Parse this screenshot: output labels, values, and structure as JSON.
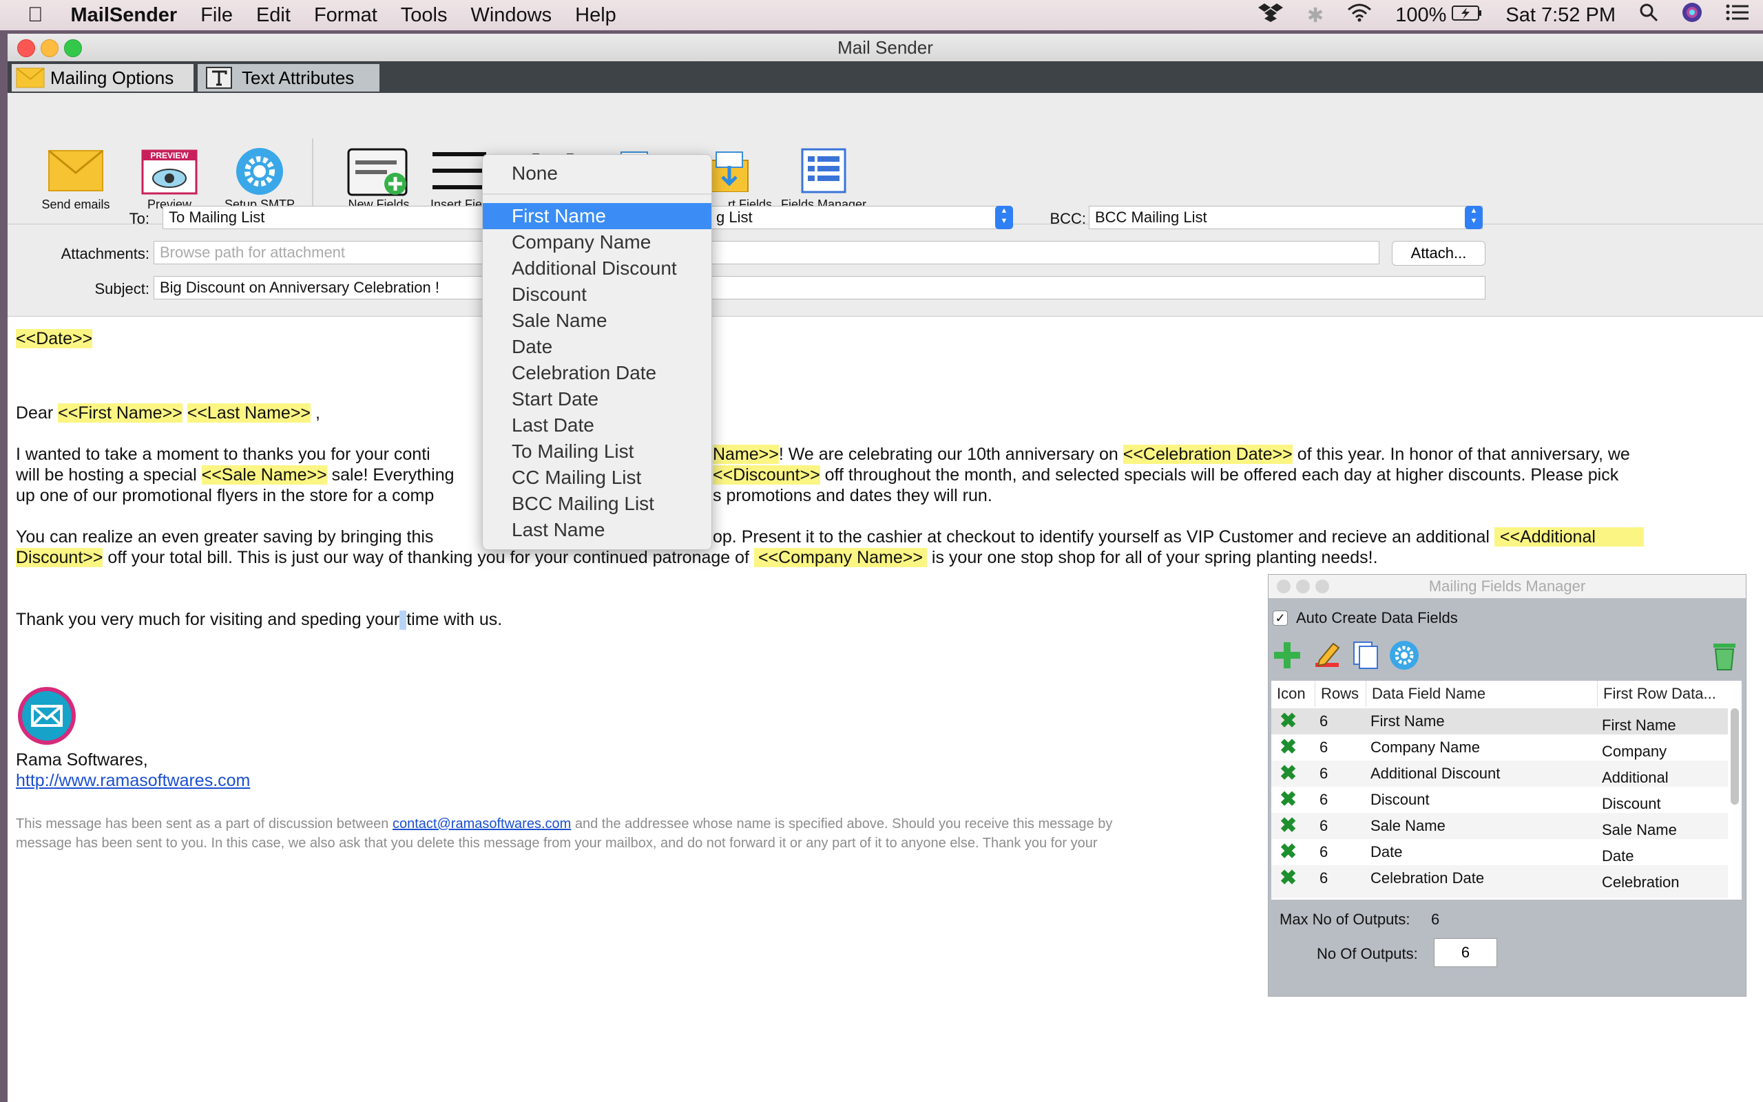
{
  "menubar": {
    "app": "MailSender",
    "items": [
      "File",
      "Edit",
      "Format",
      "Tools",
      "Windows",
      "Help"
    ],
    "battery": "100%",
    "clock": "Sat 7:52 PM"
  },
  "window": {
    "title": "Mail Sender",
    "tabs": [
      "Mailing Options",
      "Text Attributes"
    ]
  },
  "toolbar": {
    "send": "Send emails",
    "preview": "Preview",
    "preview_badge": "PREVIEW",
    "smtp": "Setup SMTP",
    "new_fields": "New Fields",
    "insert_fields": "Insert Fie",
    "export_fields": "rt Fields",
    "fields_manager": "Fields Manager"
  },
  "form": {
    "to_label": "To:",
    "to_value": "To Mailing List",
    "cc_value_partial": "g List",
    "bcc_label": "BCC:",
    "bcc_value": "BCC Mailing List",
    "attach_label": "Attachments:",
    "attach_placeholder": "Browse path for attachment",
    "attach_button": "Attach...",
    "subject_label": "Subject:",
    "subject_value": "Big Discount on Anniversary Celebration !"
  },
  "editor": {
    "date_tag": "<<Date>>",
    "dear": "Dear",
    "first_name_tag": "<<First Name>>",
    "last_name_tag": "<<Last Name>>",
    "comma": ",",
    "p1_l1_a": "I wanted to take a moment to thanks you for your conti",
    "p1_l1_tag": "Name>>",
    "p1_l1_b": "! We are celebrating our 10th anniversary on",
    "celebration_tag": "<<Celebration Date>>",
    "p1_l1_c": "of this year. In honor of that anniversary, we",
    "p1_l2_a": "will be hosting a special",
    "sale_tag": "<<Sale Name>>",
    "p1_l2_b": "sale! Everything",
    "discount_tag": "<<Discount>>",
    "p1_l2_c": "off throughout the month, and selected specials will be offered each day at higher discounts. Please pick",
    "p1_l3_a": "up one of our promotional flyers in the store for a comp",
    "p1_l3_b": "s promotions and dates they will run.",
    "p2_l1_a": "You can realize an even greater saving by bringing this",
    "p2_l1_b": "op. Present it to the cashier at checkout to identify yourself as VIP Customer and recieve an additional",
    "additional_tag": "<<Additional",
    "discount_cont_tag": "Discount>>",
    "p2_l2_b": "off your total bill. This is just our way of thanking you for your continued patronage of",
    "company_tag": "<<Company Name>>",
    "p2_l2_c": "is your one stop shop for all of your spring planting needs!.",
    "thanks_a": "Thank you very much for visiting and speding your",
    "thanks_b": "time with us.",
    "company": "Rama Softwares,",
    "website": "http://www.ramasoftwares.com",
    "footer_l1_a": "This message has been sent as a part of discussion between",
    "footer_email": "contact@ramasoftwares.com",
    "footer_l1_b": "and the addressee whose name is specified above. Should you receive this message by",
    "footer_l2": "message has been sent to you. In this case, we also ask that you delete this message from your mailbox, and do not forward it or any part of it to anyone else. Thank you for your"
  },
  "dropdown": {
    "items": [
      "None",
      "First Name",
      "Company Name",
      "Additional Discount",
      "Discount",
      "Sale Name",
      "Date",
      "Celebration Date",
      "Start Date",
      "Last Date",
      "To Mailing List",
      "CC Mailing List",
      "BCC Mailing List",
      "Last Name"
    ],
    "selected": "First Name"
  },
  "fields_manager": {
    "title": "Mailing Fields Manager",
    "auto_create": "Auto Create Data Fields",
    "auto_create_checked": true,
    "columns": [
      "Icon",
      "Rows",
      "Data Field Name",
      "First Row Data..."
    ],
    "rows": [
      {
        "rows": "6",
        "name": "First Name",
        "first": "First Name"
      },
      {
        "rows": "6",
        "name": "Company Name",
        "first": "Company"
      },
      {
        "rows": "6",
        "name": "Additional Discount",
        "first": "Additional"
      },
      {
        "rows": "6",
        "name": "Discount",
        "first": "Discount"
      },
      {
        "rows": "6",
        "name": "Sale Name",
        "first": "Sale Name"
      },
      {
        "rows": "6",
        "name": "Date",
        "first": "Date"
      },
      {
        "rows": "6",
        "name": "Celebration Date",
        "first": "Celebration"
      }
    ],
    "max_outputs_label": "Max No of Outputs:",
    "max_outputs_value": "6",
    "no_outputs_label": "No Of Outputs:",
    "no_outputs_value": "6"
  },
  "colors": {
    "highlight": "#fbf583",
    "selection": "#3b8df5",
    "tab_strip": "#3e4347"
  }
}
